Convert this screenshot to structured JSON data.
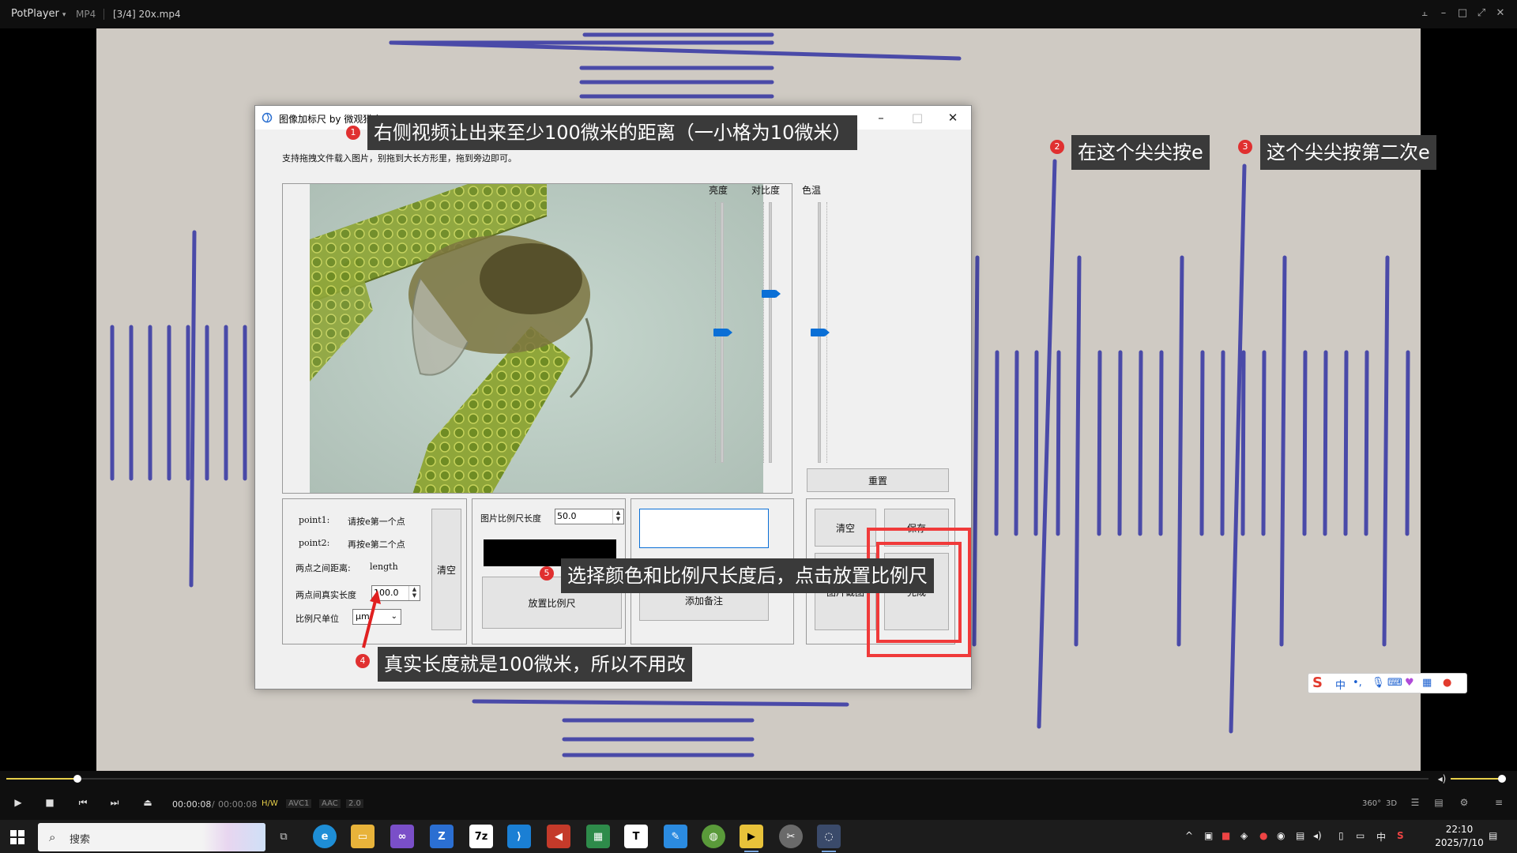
{
  "player": {
    "brand": "PotPlayer",
    "format": "MP4",
    "file": "[3/4] 20x.mp4"
  },
  "app_window": {
    "title": "图像加标尺  by 微观猎人",
    "hint": "支持拖拽文件载入图片，别拖到大长方形里，拖到旁边即可。",
    "sliders": {
      "brightness_label": "亮度",
      "contrast_label": "对比度",
      "temperature_label": "色温",
      "brightness_level": 0.5,
      "contrast_level": 0.65,
      "temperature_level": 0.5
    },
    "reset_button": "重置",
    "measure_panel": {
      "point1_label": "point1:",
      "point1_value": "请按e第一个点",
      "point2_label": "point2:",
      "point2_value": "再按e第二个点",
      "distance_label": "两点之间距离:",
      "distance_value": "length",
      "real_length_label": "两点间真实长度",
      "real_length_value": "100.0",
      "unit_label": "比例尺单位",
      "unit_value": "μm",
      "clear_button": "清空"
    },
    "scale_panel": {
      "length_label": "图片比例尺长度",
      "length_value": "50.0",
      "place_button": "放置比例尺"
    },
    "note_panel": {
      "add_note_button": "添加备注"
    },
    "action_panel": {
      "clear_button": "清空",
      "save_button": "保存",
      "crop_button": "图片截图",
      "done_button": "完成"
    }
  },
  "callouts": [
    {
      "num": "1",
      "text": "右侧视频让出来至少100微米的距离（一小格为10微米）"
    },
    {
      "num": "2",
      "text": "在这个尖尖按e"
    },
    {
      "num": "3",
      "text": "这个尖尖按第二次e"
    },
    {
      "num": "4",
      "text": "真实长度就是100微米，所以不用改"
    },
    {
      "num": "5",
      "text": "选择颜色和比例尺长度后，点击放置比例尺"
    }
  ],
  "ime": {
    "lang": "中",
    "punct": "•,"
  },
  "controls": {
    "current_time": "00:00:08",
    "divider": "/",
    "total_time": "00:00:08",
    "hw": "H/W",
    "vcodec": "AVC1",
    "acodec": "AAC",
    "channels": "2.0",
    "progress": 0.05,
    "volume": 1.0,
    "right_labels": [
      "360°",
      "3D"
    ]
  },
  "taskbar": {
    "search_placeholder": "搜索",
    "time": "22:10",
    "date": "2025/7/10",
    "ime_indicator": "中"
  }
}
